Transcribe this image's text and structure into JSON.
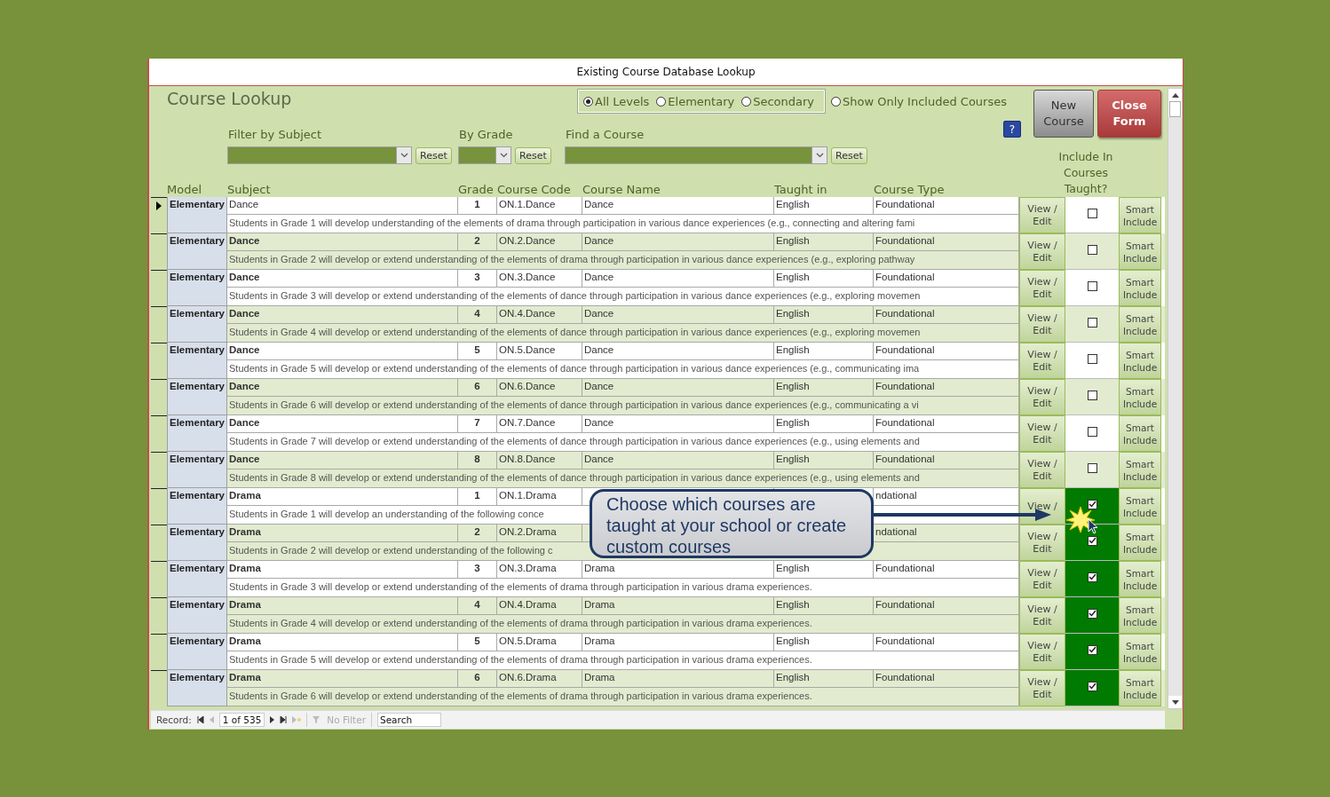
{
  "window": {
    "title": "Existing Course Database Lookup"
  },
  "form": {
    "title": "Course Lookup",
    "level_options": [
      {
        "label": "All Levels",
        "selected": true
      },
      {
        "label": "Elementary",
        "selected": false
      },
      {
        "label": "Secondary",
        "selected": false
      }
    ],
    "show_only_included": {
      "label": "Show Only Included Courses",
      "checked": false
    },
    "help_button": "?",
    "new_course_button": "New Course",
    "close_form_button": "Close Form",
    "filters": [
      {
        "label": "Filter by Subject",
        "reset": "Reset"
      },
      {
        "label": "By Grade",
        "reset": "Reset"
      },
      {
        "label": "Find a Course",
        "reset": "Reset"
      }
    ],
    "include_header": "Include In Courses Taught?",
    "columns": [
      "Model",
      "Subject",
      "Grade",
      "Course Code",
      "Course Name",
      "Taught in",
      "Course Type"
    ]
  },
  "rows": [
    {
      "current": true,
      "model": "Elementary",
      "subject": "Dance",
      "grade": "1",
      "code": "ON.1.Dance",
      "name": "Dance",
      "taught_in": "English",
      "type": "Foundational",
      "description": "Students in Grade 1 will develop understanding of the elements of drama through participation in various dance experiences (e.g., connecting and altering fami",
      "view_edit": "View / Edit",
      "included": false,
      "smart": "Smart Include"
    },
    {
      "current": false,
      "model": "Elementary",
      "subject": "Dance",
      "grade": "2",
      "code": "ON.2.Dance",
      "name": "Dance",
      "taught_in": "English",
      "type": "Foundational",
      "description": "Students in Grade 2 will develop or extend understanding of the elements of drama through participation in various dance experiences (e.g., exploring pathway",
      "view_edit": "View / Edit",
      "included": false,
      "smart": "Smart Include"
    },
    {
      "current": false,
      "model": "Elementary",
      "subject": "Dance",
      "grade": "3",
      "code": "ON.3.Dance",
      "name": "Dance",
      "taught_in": "English",
      "type": "Foundational",
      "description": "Students in Grade 3 will develop or extend understanding of the elements of dance through participation in various dance experiences (e.g., exploring movemen",
      "view_edit": "View / Edit",
      "included": false,
      "smart": "Smart Include"
    },
    {
      "current": false,
      "model": "Elementary",
      "subject": "Dance",
      "grade": "4",
      "code": "ON.4.Dance",
      "name": "Dance",
      "taught_in": "English",
      "type": "Foundational",
      "description": "Students in Grade 4 will develop or extend understanding of the elements of dance through participation in various dance experiences (e.g., exploring movemen",
      "view_edit": "View / Edit",
      "included": false,
      "smart": "Smart Include"
    },
    {
      "current": false,
      "model": "Elementary",
      "subject": "Dance",
      "grade": "5",
      "code": "ON.5.Dance",
      "name": "Dance",
      "taught_in": "English",
      "type": "Foundational",
      "description": "Students in Grade 5 will develop or extend understanding of the elements of dance through participation in various dance experiences (e.g., communicating ima",
      "view_edit": "View / Edit",
      "included": false,
      "smart": "Smart Include"
    },
    {
      "current": false,
      "model": "Elementary",
      "subject": "Dance",
      "grade": "6",
      "code": "ON.6.Dance",
      "name": "Dance",
      "taught_in": "English",
      "type": "Foundational",
      "description": "Students in Grade 6 will develop or extend understanding of the elements of dance through participation in various dance experiences (e.g., communicating a vi",
      "view_edit": "View / Edit",
      "included": false,
      "smart": "Smart Include"
    },
    {
      "current": false,
      "model": "Elementary",
      "subject": "Dance",
      "grade": "7",
      "code": "ON.7.Dance",
      "name": "Dance",
      "taught_in": "English",
      "type": "Foundational",
      "description": "Students in Grade 7 will develop or extend understanding of the elements of dance through participation in various dance experiences (e.g., using elements and",
      "view_edit": "View / Edit",
      "included": false,
      "smart": "Smart Include"
    },
    {
      "current": false,
      "model": "Elementary",
      "subject": "Dance",
      "grade": "8",
      "code": "ON.8.Dance",
      "name": "Dance",
      "taught_in": "English",
      "type": "Foundational",
      "description": "Students in Grade 8 will develop or extend understanding of the elements of dance through participation in various dance experiences (e.g., using elements and",
      "view_edit": "View / Edit",
      "included": false,
      "smart": "Smart Include"
    },
    {
      "current": false,
      "model": "Elementary",
      "subject": "Drama",
      "grade": "1",
      "code": "ON.1.Drama",
      "type": "ndational",
      "description": "Students in Grade 1 will develop an understanding of the following conce",
      "view_edit": "View /",
      "included": true,
      "smart": "Smart Include"
    },
    {
      "current": false,
      "model": "Elementary",
      "subject": "Drama",
      "grade": "2",
      "code": "ON.2.Drama",
      "type": "ndational",
      "description": "Students in Grade 2 will develop or extend understanding of the following c",
      "view_edit": "View / Edit",
      "included": true,
      "smart": "Smart Include"
    },
    {
      "current": false,
      "model": "Elementary",
      "subject": "Drama",
      "grade": "3",
      "code": "ON.3.Drama",
      "name": "Drama",
      "taught_in": "English",
      "type": "Foundational",
      "description": "Students in Grade 3 will develop or extend understanding of the elements of drama through participation in various drama experiences.",
      "view_edit": "View / Edit",
      "included": true,
      "smart": "Smart Include"
    },
    {
      "current": false,
      "model": "Elementary",
      "subject": "Drama",
      "grade": "4",
      "code": "ON.4.Drama",
      "name": "Drama",
      "taught_in": "English",
      "type": "Foundational",
      "description": "Students in Grade 4 will develop or extend understanding of the elements of drama through participation in various drama experiences.",
      "view_edit": "View / Edit",
      "included": true,
      "smart": "Smart Include"
    },
    {
      "current": false,
      "model": "Elementary",
      "subject": "Drama",
      "grade": "5",
      "code": "ON.5.Drama",
      "name": "Drama",
      "taught_in": "English",
      "type": "Foundational",
      "description": "Students in Grade 5 will develop or extend understanding of the elements of drama through participation in various drama experiences.",
      "view_edit": "View / Edit",
      "included": true,
      "smart": "Smart Include"
    },
    {
      "current": false,
      "model": "Elementary",
      "subject": "Drama",
      "grade": "6",
      "code": "ON.6.Drama",
      "name": "Drama",
      "taught_in": "English",
      "type": "Foundational",
      "description": "Students in Grade 6 will develop or extend understanding of the elements of drama through participation in various drama experiences.",
      "view_edit": "View / Edit",
      "included": true,
      "smart": "Smart Include"
    }
  ],
  "callout": {
    "text": "Choose which courses are taught at your school or create custom courses"
  },
  "record_bar": {
    "label": "Record:",
    "position": "1 of 535",
    "filter": "No Filter",
    "search_placeholder": "Search"
  }
}
